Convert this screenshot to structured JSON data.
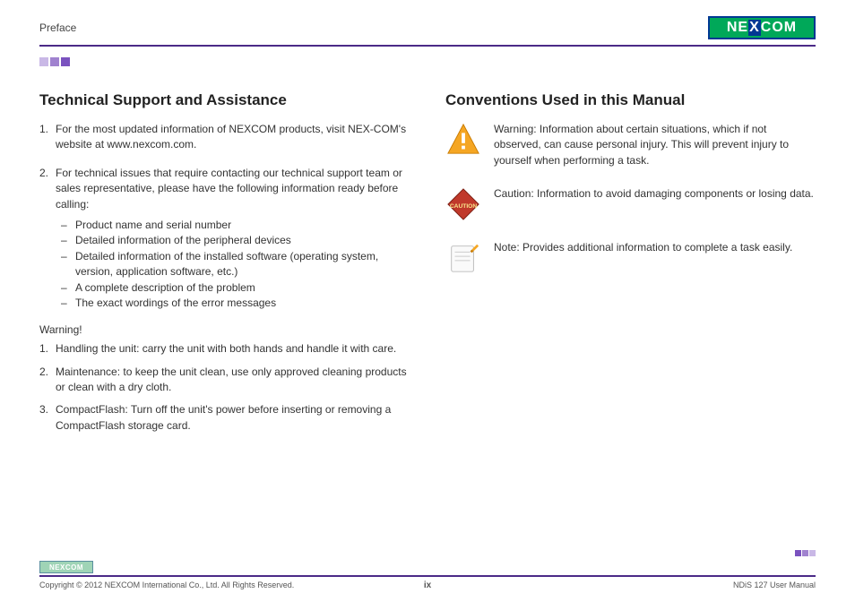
{
  "header": {
    "section_label": "Preface",
    "logo_text_left": "NE",
    "logo_text_x": "X",
    "logo_text_right": "COM"
  },
  "left": {
    "heading": "Technical Support and Assistance",
    "item1_num": "1.",
    "item1_text": "For the most updated information of NEXCOM products, visit NEX-COM's website at www.nexcom.com.",
    "item2_num": "2.",
    "item2_text": "For technical issues that require contacting our technical support team or sales representative, please have the following information ready before calling:",
    "sub1": "Product name and serial number",
    "sub2": "Detailed information of the peripheral devices",
    "sub3": "Detailed information of the installed software (operating system, version, application software, etc.)",
    "sub4": "A complete description of the problem",
    "sub5": "The exact wordings of the error messages",
    "warning_head": "Warning!",
    "w1_num": "1.",
    "w1_text": "Handling the unit: carry the unit with both hands and handle it with care.",
    "w2_num": "2.",
    "w2_text": "Maintenance: to keep the unit clean, use only approved cleaning products or clean with a dry cloth.",
    "w3_num": "3.",
    "w3_text": "CompactFlash: Turn off the unit's power before inserting or removing a CompactFlash storage card."
  },
  "right": {
    "heading": "Conventions Used in this Manual",
    "warning_text": "Warning: Information about certain situations, which if not observed, can cause personal injury. This will prevent injury to yourself when performing a task.",
    "caution_text": "Caution: Information to avoid damaging components or losing data.",
    "note_text": "Note: Provides additional information to complete a task easily."
  },
  "footer": {
    "copyright": "Copyright © 2012 NEXCOM International Co., Ltd. All Rights Reserved.",
    "page_num": "ix",
    "doc_title": "NDiS 127 User Manual",
    "footer_logo": "NEXCOM"
  }
}
